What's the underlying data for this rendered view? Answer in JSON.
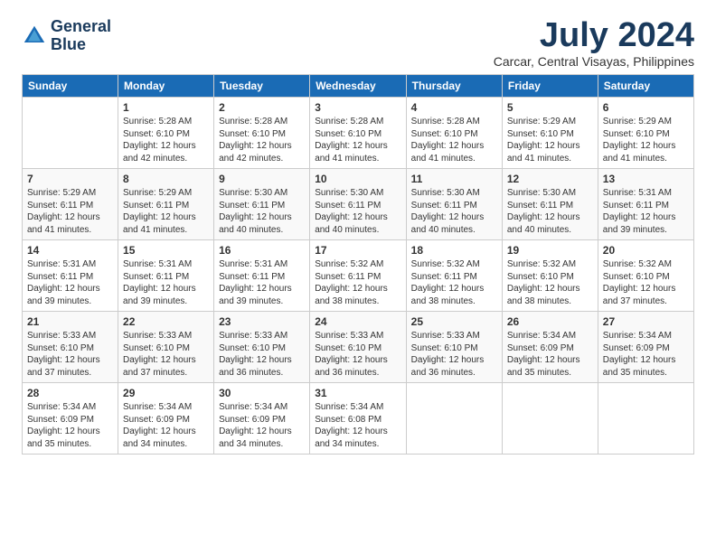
{
  "header": {
    "logo_line1": "General",
    "logo_line2": "Blue",
    "title": "July 2024",
    "subtitle": "Carcar, Central Visayas, Philippines"
  },
  "calendar": {
    "days_of_week": [
      "Sunday",
      "Monday",
      "Tuesday",
      "Wednesday",
      "Thursday",
      "Friday",
      "Saturday"
    ],
    "weeks": [
      [
        {
          "day": "",
          "info": ""
        },
        {
          "day": "1",
          "info": "Sunrise: 5:28 AM\nSunset: 6:10 PM\nDaylight: 12 hours\nand 42 minutes."
        },
        {
          "day": "2",
          "info": "Sunrise: 5:28 AM\nSunset: 6:10 PM\nDaylight: 12 hours\nand 42 minutes."
        },
        {
          "day": "3",
          "info": "Sunrise: 5:28 AM\nSunset: 6:10 PM\nDaylight: 12 hours\nand 41 minutes."
        },
        {
          "day": "4",
          "info": "Sunrise: 5:28 AM\nSunset: 6:10 PM\nDaylight: 12 hours\nand 41 minutes."
        },
        {
          "day": "5",
          "info": "Sunrise: 5:29 AM\nSunset: 6:10 PM\nDaylight: 12 hours\nand 41 minutes."
        },
        {
          "day": "6",
          "info": "Sunrise: 5:29 AM\nSunset: 6:10 PM\nDaylight: 12 hours\nand 41 minutes."
        }
      ],
      [
        {
          "day": "7",
          "info": "Sunrise: 5:29 AM\nSunset: 6:11 PM\nDaylight: 12 hours\nand 41 minutes."
        },
        {
          "day": "8",
          "info": "Sunrise: 5:29 AM\nSunset: 6:11 PM\nDaylight: 12 hours\nand 41 minutes."
        },
        {
          "day": "9",
          "info": "Sunrise: 5:30 AM\nSunset: 6:11 PM\nDaylight: 12 hours\nand 40 minutes."
        },
        {
          "day": "10",
          "info": "Sunrise: 5:30 AM\nSunset: 6:11 PM\nDaylight: 12 hours\nand 40 minutes."
        },
        {
          "day": "11",
          "info": "Sunrise: 5:30 AM\nSunset: 6:11 PM\nDaylight: 12 hours\nand 40 minutes."
        },
        {
          "day": "12",
          "info": "Sunrise: 5:30 AM\nSunset: 6:11 PM\nDaylight: 12 hours\nand 40 minutes."
        },
        {
          "day": "13",
          "info": "Sunrise: 5:31 AM\nSunset: 6:11 PM\nDaylight: 12 hours\nand 39 minutes."
        }
      ],
      [
        {
          "day": "14",
          "info": "Sunrise: 5:31 AM\nSunset: 6:11 PM\nDaylight: 12 hours\nand 39 minutes."
        },
        {
          "day": "15",
          "info": "Sunrise: 5:31 AM\nSunset: 6:11 PM\nDaylight: 12 hours\nand 39 minutes."
        },
        {
          "day": "16",
          "info": "Sunrise: 5:31 AM\nSunset: 6:11 PM\nDaylight: 12 hours\nand 39 minutes."
        },
        {
          "day": "17",
          "info": "Sunrise: 5:32 AM\nSunset: 6:11 PM\nDaylight: 12 hours\nand 38 minutes."
        },
        {
          "day": "18",
          "info": "Sunrise: 5:32 AM\nSunset: 6:11 PM\nDaylight: 12 hours\nand 38 minutes."
        },
        {
          "day": "19",
          "info": "Sunrise: 5:32 AM\nSunset: 6:10 PM\nDaylight: 12 hours\nand 38 minutes."
        },
        {
          "day": "20",
          "info": "Sunrise: 5:32 AM\nSunset: 6:10 PM\nDaylight: 12 hours\nand 37 minutes."
        }
      ],
      [
        {
          "day": "21",
          "info": "Sunrise: 5:33 AM\nSunset: 6:10 PM\nDaylight: 12 hours\nand 37 minutes."
        },
        {
          "day": "22",
          "info": "Sunrise: 5:33 AM\nSunset: 6:10 PM\nDaylight: 12 hours\nand 37 minutes."
        },
        {
          "day": "23",
          "info": "Sunrise: 5:33 AM\nSunset: 6:10 PM\nDaylight: 12 hours\nand 36 minutes."
        },
        {
          "day": "24",
          "info": "Sunrise: 5:33 AM\nSunset: 6:10 PM\nDaylight: 12 hours\nand 36 minutes."
        },
        {
          "day": "25",
          "info": "Sunrise: 5:33 AM\nSunset: 6:10 PM\nDaylight: 12 hours\nand 36 minutes."
        },
        {
          "day": "26",
          "info": "Sunrise: 5:34 AM\nSunset: 6:09 PM\nDaylight: 12 hours\nand 35 minutes."
        },
        {
          "day": "27",
          "info": "Sunrise: 5:34 AM\nSunset: 6:09 PM\nDaylight: 12 hours\nand 35 minutes."
        }
      ],
      [
        {
          "day": "28",
          "info": "Sunrise: 5:34 AM\nSunset: 6:09 PM\nDaylight: 12 hours\nand 35 minutes."
        },
        {
          "day": "29",
          "info": "Sunrise: 5:34 AM\nSunset: 6:09 PM\nDaylight: 12 hours\nand 34 minutes."
        },
        {
          "day": "30",
          "info": "Sunrise: 5:34 AM\nSunset: 6:09 PM\nDaylight: 12 hours\nand 34 minutes."
        },
        {
          "day": "31",
          "info": "Sunrise: 5:34 AM\nSunset: 6:08 PM\nDaylight: 12 hours\nand 34 minutes."
        },
        {
          "day": "",
          "info": ""
        },
        {
          "day": "",
          "info": ""
        },
        {
          "day": "",
          "info": ""
        }
      ]
    ]
  }
}
